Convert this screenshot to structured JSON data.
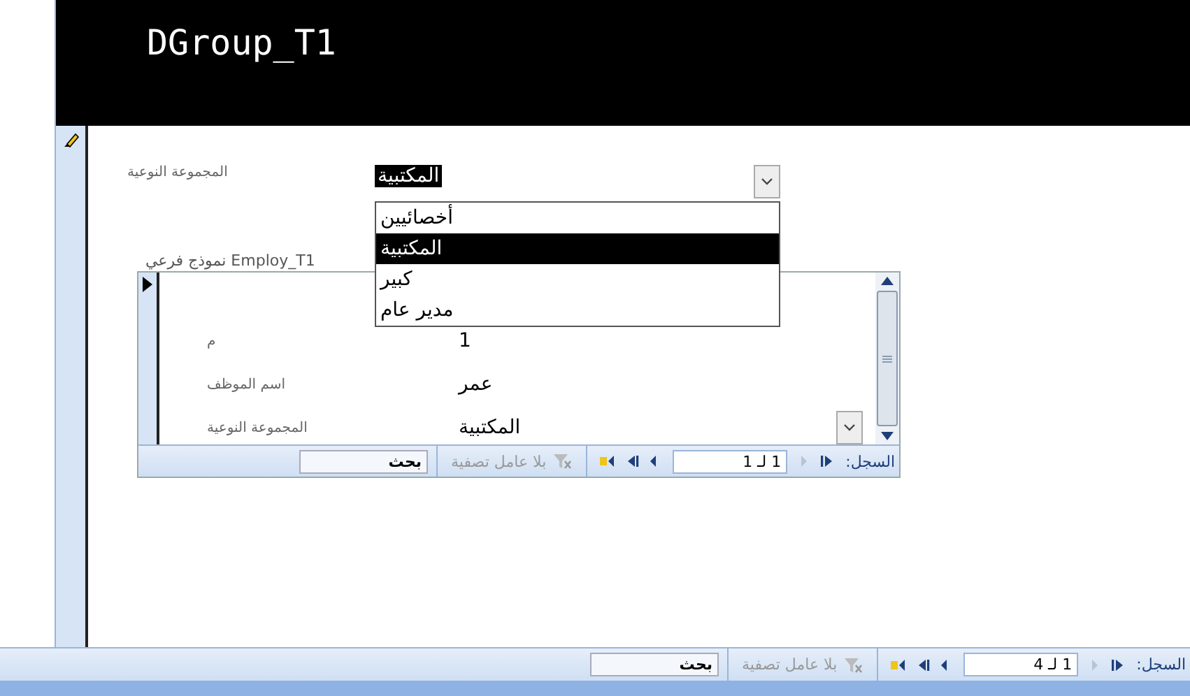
{
  "form_title": "DGroup_T1",
  "main": {
    "group_label": "المجموعة النوعية",
    "group_combo": {
      "value": "المكتبية",
      "expanded": true,
      "options": [
        {
          "label": "أخصائيين",
          "selected": false
        },
        {
          "label": "المكتبية",
          "selected": true
        },
        {
          "label": "كبير",
          "selected": false
        },
        {
          "label": "مدير عام",
          "selected": false
        }
      ]
    }
  },
  "subform": {
    "label": "نموذج فرعي Employ_T1",
    "fields": [
      {
        "label": "م",
        "value": "1",
        "kind": "text"
      },
      {
        "label": "اسم الموظف",
        "value": "عمر",
        "kind": "text"
      },
      {
        "label": "المجموعة النوعية",
        "value": "المكتبية",
        "kind": "combo"
      }
    ],
    "nav": {
      "label": "السجل:",
      "position": "1 لـ 1",
      "filter": "بلا عامل تصفية",
      "search": "بحث",
      "buttons": [
        {
          "kind": "first",
          "disabled": false
        },
        {
          "kind": "prev",
          "disabled": true
        },
        {
          "kind": "next",
          "disabled": false
        },
        {
          "kind": "last",
          "disabled": false
        },
        {
          "kind": "new",
          "disabled": false
        }
      ]
    }
  },
  "nav": {
    "label": "السجل:",
    "position": "1 لـ 4",
    "filter": "بلا عامل تصفية",
    "search": "بحث",
    "buttons": [
      {
        "kind": "first",
        "disabled": false
      },
      {
        "kind": "prev",
        "disabled": true
      },
      {
        "kind": "next",
        "disabled": false
      },
      {
        "kind": "last",
        "disabled": false
      },
      {
        "kind": "new",
        "disabled": false
      }
    ]
  }
}
